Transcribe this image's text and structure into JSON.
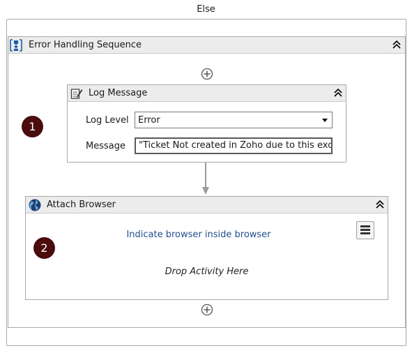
{
  "else_title": "Else",
  "sequence": {
    "title": "Error Handling Sequence",
    "icon": "sequence-icon"
  },
  "log_message": {
    "title": "Log Message",
    "icon": "log-message-icon",
    "level_label": "Log Level",
    "level_value": "Error",
    "message_label": "Message",
    "message_value": "\"Ticket Not created in Zoho due to this exc"
  },
  "attach_browser": {
    "title": "Attach Browser",
    "icon": "browser-globe-icon",
    "indicate_link": "Indicate browser inside browser",
    "drop_hint": "Drop Activity Here"
  },
  "badges": [
    "1",
    "2"
  ],
  "colors": {
    "header_bg": "#ececec",
    "badge_bg": "#4a0c0c",
    "link": "#1f4e8c",
    "sequence_icon": "#1e5aa8"
  }
}
